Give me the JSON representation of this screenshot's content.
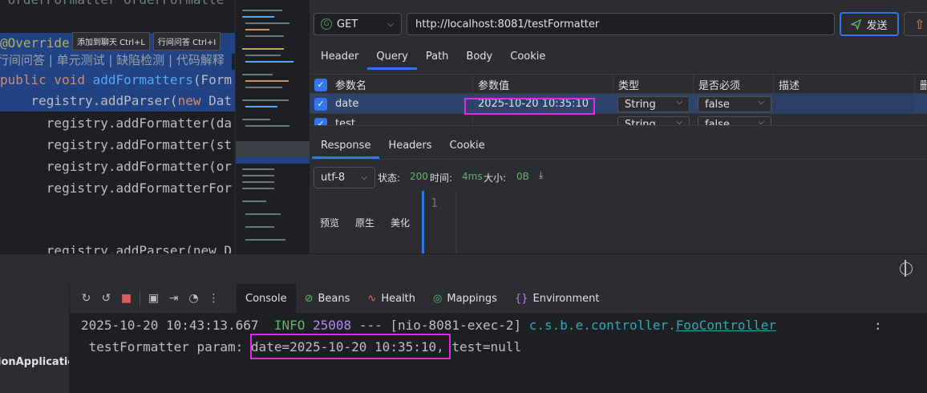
{
  "editor": {
    "lines": [
      {
        "indent": "",
        "text": " orderFormatter orderFormatte",
        "style": "gr"
      },
      {
        "indent": "",
        "text": "@Override",
        "style": "an"
      },
      {
        "indent": "",
        "text": "行间问答 | 单元测试 | 缺陷检测 | 代码解释",
        "style": "gr"
      },
      {
        "indent": "",
        "kw": "public void ",
        "fn": "addFormatters",
        "rest": "(Form"
      },
      {
        "indent": "    ",
        "tx": "registry.addParser(",
        "kw": "new ",
        "rest": "Dat"
      },
      {
        "text": "      registry.addFormatter(da"
      },
      {
        "text": "      registry.addFormatter(st"
      },
      {
        "text": "      registry.addFormatter(or"
      },
      {
        "text": "      registry.addFormatterFor"
      },
      {
        "text": "      registry.addParser(new D"
      }
    ],
    "tooltips": [
      "添加到聊天 Ctrl+L",
      "行间问答 Ctrl+I"
    ]
  },
  "request": {
    "method": "GET",
    "method_icon": "G",
    "url": "http://localhost:8081/testFormatter",
    "send_label": "发送",
    "tabs": [
      "Header",
      "Query",
      "Path",
      "Body",
      "Cookie"
    ],
    "active_tab": "Query",
    "param_headers": [
      "参数名",
      "参数值",
      "类型",
      "是否必须",
      "描述",
      "删"
    ],
    "params": [
      {
        "name": "date",
        "value": "2025-10-20 10:35:10",
        "type": "String",
        "required": "false"
      },
      {
        "name": "test",
        "value": "",
        "type": "String",
        "required": "false"
      }
    ]
  },
  "response": {
    "tabs": [
      "Response",
      "Headers",
      "Cookie"
    ],
    "active_tab": "Response",
    "encoding": "utf-8",
    "status_label": "状态:",
    "status": "200",
    "time_label": "时间:",
    "time": "4ms",
    "size_label": "大小:",
    "size": "0B",
    "view_tabs": [
      "预览",
      "原生",
      "美化"
    ],
    "line_number": "1"
  },
  "services": {
    "app_name": "ionApplication"
  },
  "console": {
    "tabs": [
      {
        "label": "Console",
        "icon": ""
      },
      {
        "label": "Beans",
        "icon": "beans-icon"
      },
      {
        "label": "Health",
        "icon": "health-icon"
      },
      {
        "label": "Mappings",
        "icon": "mappings-icon"
      },
      {
        "label": "Environment",
        "icon": "environment-icon"
      }
    ],
    "active_tab": "Console",
    "log": {
      "timestamp": "2025-10-20 10:43:13.667",
      "level": "INFO",
      "pid": "25008",
      "sep": "---",
      "thread": "[nio-8081-exec-2]",
      "logger_pkg": "c.s.b.e.controller.",
      "logger_class": "FooController",
      "colon": ":",
      "message_prefix": " testFormatter param: ",
      "message_highlight": "date=2025-10-20 10:35:10",
      "message_suffix": ", test=null"
    }
  },
  "colors": {
    "accent": "#3574f0",
    "highlight_box": "#e329e3",
    "info_green": "#5fb865",
    "pid_purple": "#b189f5",
    "logger_teal": "#2aacb8"
  }
}
